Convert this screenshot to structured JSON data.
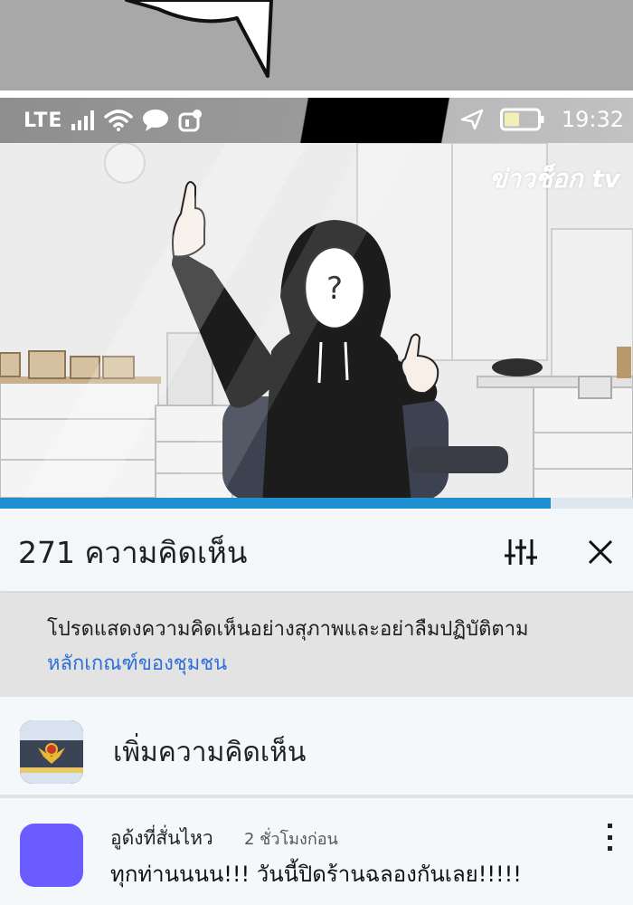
{
  "status_bar": {
    "network": "LTE",
    "time": "19:32"
  },
  "video": {
    "watermark": "ข่าวช็อก tv",
    "progress_fraction": 0.87
  },
  "comments_sheet": {
    "count_title": "271 ความคิดเห็น",
    "notice_text": "โปรดแสดงความคิดเห็นอย่างสุภาพและอย่าลืมปฏิบัติตาม",
    "notice_link": "หลักเกณฑ์ของชุมชน",
    "add_comment_placeholder": "เพิ่มความคิดเห็น",
    "comments": [
      {
        "author": "อูด้งที่สั่นไหว",
        "time": "2 ชั่วโมงก่อน",
        "text": "ทุกท่านนนน!!! วันนี้ปิดร้านฉลองกันเลย!!!!!",
        "avatar_color": "#6a5cff"
      }
    ]
  },
  "colors": {
    "accent": "#1e8fd0",
    "link": "#2f6fd8"
  }
}
